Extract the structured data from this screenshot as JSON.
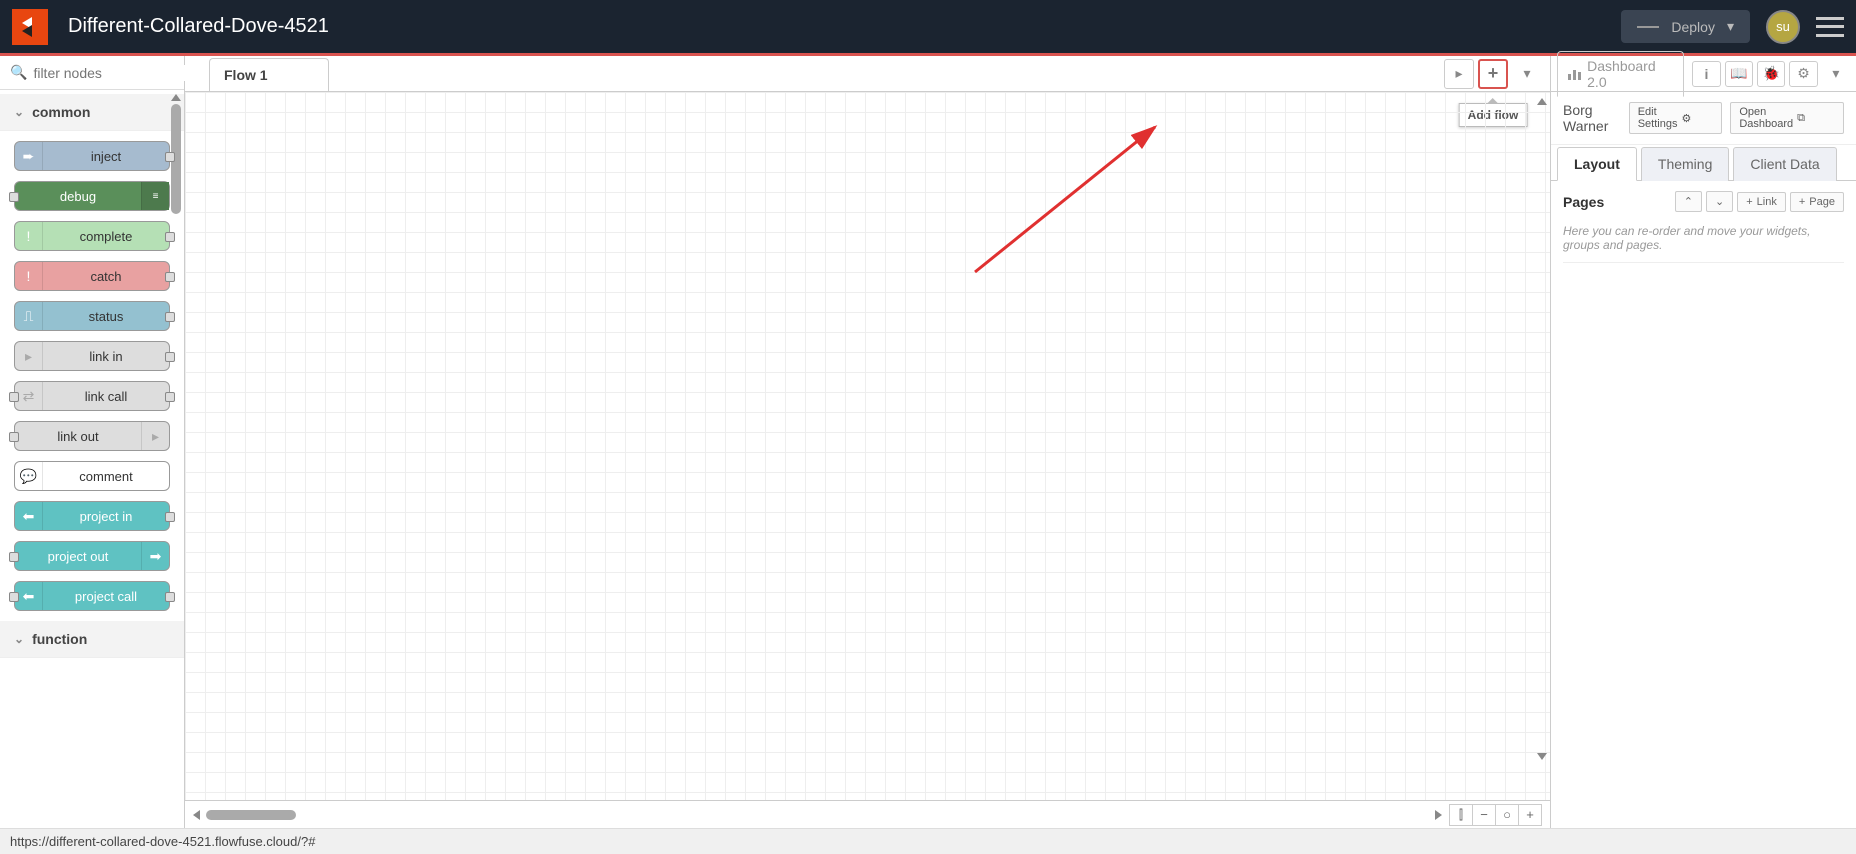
{
  "header": {
    "title": "Different-Collared-Dove-4521",
    "deploy_label": "Deploy",
    "avatar_initials": "su"
  },
  "palette": {
    "filter_placeholder": "filter nodes",
    "categories": [
      {
        "name": "common",
        "nodes": [
          "inject",
          "debug",
          "complete",
          "catch",
          "status",
          "link in",
          "link call",
          "link out",
          "comment",
          "project in",
          "project out",
          "project call"
        ]
      },
      {
        "name": "function",
        "nodes": []
      }
    ]
  },
  "workspace": {
    "tabs": [
      "Flow 1"
    ],
    "add_flow_tooltip": "Add flow",
    "view_buttons": [
      "⫿",
      "−",
      "○",
      "+"
    ]
  },
  "sidebar": {
    "panel_title": "Dashboard 2.0",
    "info_label": "i",
    "project_name": "Borg Warner",
    "edit_settings_label": "Edit Settings",
    "open_dashboard_label": "Open Dashboard",
    "subtabs": [
      "Layout",
      "Theming",
      "Client Data"
    ],
    "pages_title": "Pages",
    "link_label": "Link",
    "page_label": "Page",
    "hint": "Here you can re-order and move your widgets, groups and pages."
  },
  "statusbar": {
    "url": "https://different-collared-dove-4521.flowfuse.cloud/?#"
  }
}
